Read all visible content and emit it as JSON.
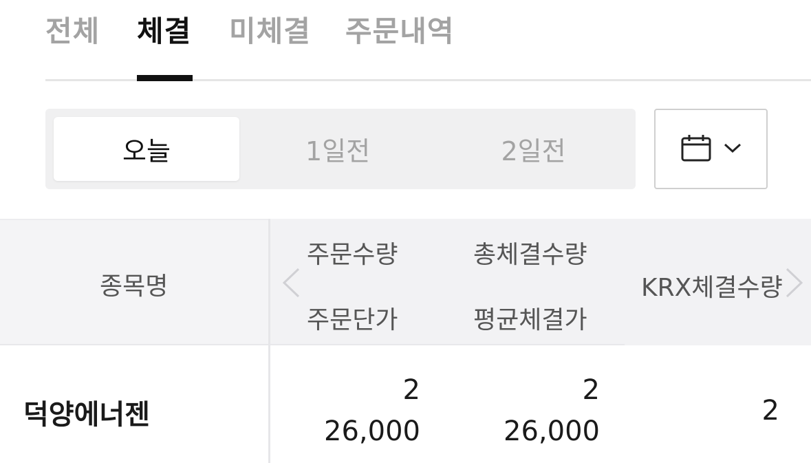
{
  "tabs": [
    {
      "label": "전체",
      "active": false
    },
    {
      "label": "체결",
      "active": true
    },
    {
      "label": "미체결",
      "active": false
    },
    {
      "label": "주문내역",
      "active": false
    }
  ],
  "segment": {
    "items": [
      {
        "label": "오늘",
        "active": true
      },
      {
        "label": "1일전",
        "active": false
      },
      {
        "label": "2일전",
        "active": false
      }
    ]
  },
  "calendar": {
    "icon": "calendar-icon",
    "dropdown_icon": "chevron-down-icon"
  },
  "table": {
    "headers": {
      "name": "종목명",
      "order_qty": "주문수량",
      "order_price": "주문단가",
      "total_exec_qty": "총체결수량",
      "avg_exec_price": "평균체결가",
      "krx_exec_qty": "KRX체결수량"
    },
    "rows": [
      {
        "name": "덕양에너젠",
        "order_qty": "2",
        "order_price": "26,000",
        "total_exec_qty": "2",
        "avg_exec_price": "26,000",
        "krx_exec_qty": "2"
      }
    ]
  },
  "colors": {
    "accent": "#111111",
    "muted": "#a3a3a3",
    "header_bg": "#f4f4f6"
  }
}
